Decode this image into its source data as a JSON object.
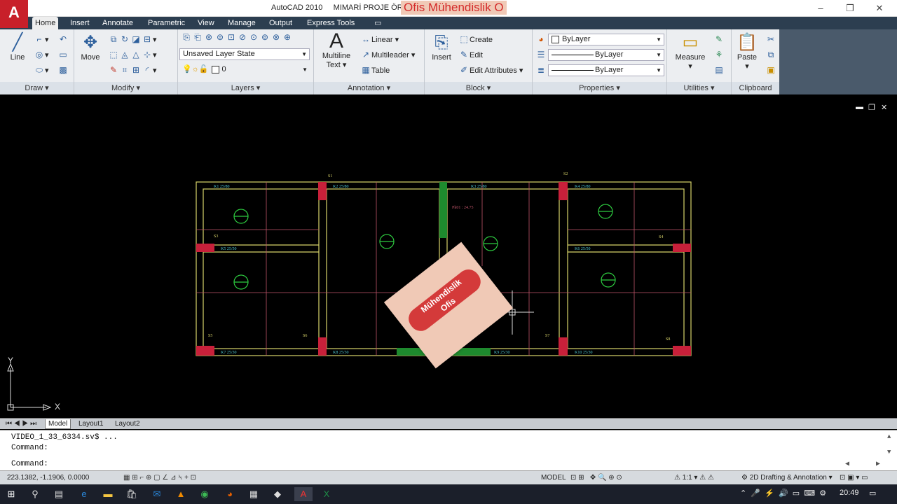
{
  "app": {
    "logo": "A",
    "title": "AutoCAD 2010",
    "document": "MIMARİ PROJE ÖRNEK VİDEO.DWG",
    "watermark_title": "Ofis Mühendislik O"
  },
  "window_controls": {
    "minimize": "–",
    "maximize": "❐",
    "close": "✕"
  },
  "tabs": [
    "Home",
    "Insert",
    "Annotate",
    "Parametric",
    "View",
    "Manage",
    "Output",
    "Express Tools",
    "▭"
  ],
  "ribbon": {
    "draw": {
      "title": "Draw",
      "line": "Line"
    },
    "modify": {
      "title": "Modify",
      "move": "Move"
    },
    "layers": {
      "title": "Layers",
      "layer_state": "Unsaved Layer State",
      "current_layer": "0"
    },
    "annotation": {
      "title": "Annotation",
      "multiline": "Multiline",
      "text": "Text",
      "linear": "Linear",
      "multileader": "Multileader",
      "table": "Table"
    },
    "block": {
      "title": "Block",
      "insert": "Insert",
      "create": "Create",
      "edit": "Edit",
      "edit_attributes": "Edit Attributes"
    },
    "properties": {
      "title": "Properties",
      "color": "ByLayer",
      "linetype": "ByLayer",
      "lineweight": "ByLayer"
    },
    "utilities": {
      "title": "Utilities",
      "measure": "Measure"
    },
    "clipboard": {
      "title": "Clipboard",
      "paste": "Paste"
    }
  },
  "viewport_controls": {
    "minimize": "▬",
    "restore": "❐",
    "close": "✕"
  },
  "drawing": {
    "beams": [
      "K1 25/80",
      "K2 25/80",
      "K3 25/80",
      "K4 25/80",
      "K5 25/50",
      "K6 25/50",
      "K7 25/30",
      "K8 25/30",
      "K9 25/30",
      "K10 25/30",
      "K11 25/30",
      "K12 25/30",
      "K13 25/30",
      "K14 25/30"
    ],
    "columns": [
      "S1",
      "S2",
      "S3",
      "S4",
      "S5",
      "S6",
      "S7",
      "S8"
    ],
    "slab_note": "Pk01 : 24.75",
    "watermark_line1": "Mühendislik",
    "watermark_line2": "Ofis"
  },
  "ucs": {
    "x": "X",
    "y": "Y"
  },
  "layout_tabs": [
    "Model",
    "Layout1",
    "Layout2"
  ],
  "command": {
    "line1": "VIDEO_1_33_6334.sv$ ...",
    "line2": "Command:",
    "prompt": "Command:"
  },
  "status": {
    "coords": "223.1382, -1.1906, 0.0000",
    "model": "MODEL",
    "scale": "1:1",
    "workspace": "2D Drafting & Annotation"
  },
  "taskbar": {
    "time": "20:49"
  }
}
